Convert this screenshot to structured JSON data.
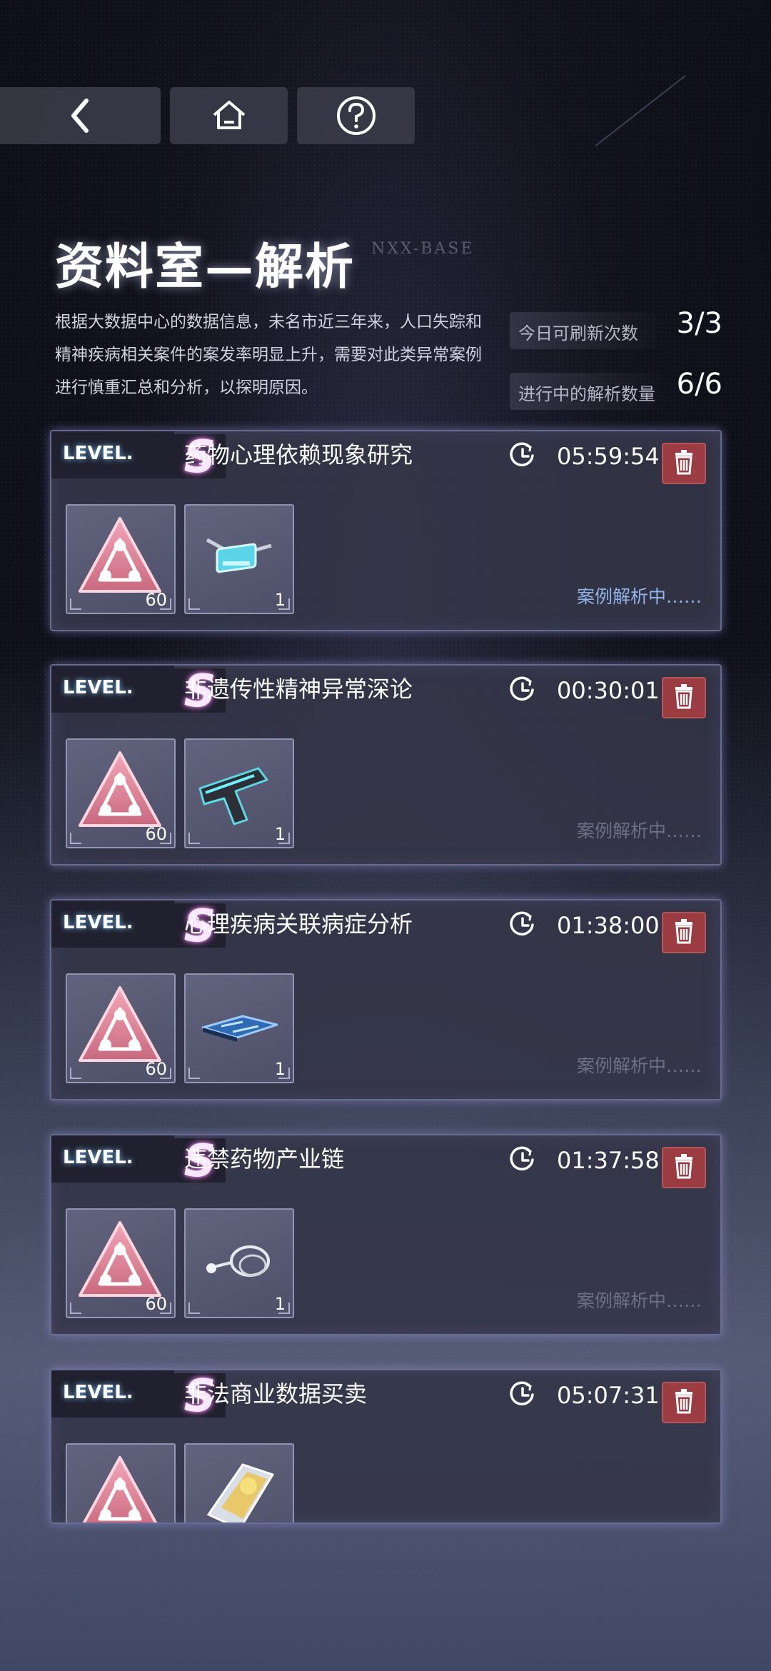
{
  "nav": {
    "back_icon": "chevron-left-icon",
    "home_icon": "home-icon",
    "help_icon": "question-circle-icon"
  },
  "header": {
    "title": "资料室—解析",
    "subtitle": "NXX-BASE",
    "description": "根据大数据中心的数据信息，未名市近三年来，人口失踪和精神疾病相关案件的案发率明显上升，需要对此类异常案例进行慎重汇总和分析，以探明原因。"
  },
  "stats": {
    "refresh_label": "今日可刷新次数",
    "refresh_value": "3/3",
    "analyzing_label": "进行中的解析数量",
    "analyzing_value": "6/6"
  },
  "colors": {
    "card_border": "#9696cd",
    "trash_bg": "#9a3c42",
    "status_active": "#8fb4e8",
    "status_inactive": "#6d6f85"
  },
  "cases": [
    {
      "level_prefix": "LEVEL.",
      "level": "S",
      "title": "药物心理依赖现象研究",
      "timer": "05:59:54",
      "item1_icon": "pink-triangle-emblem-icon",
      "item1_qty": "60",
      "item2_icon": "glasses-icon",
      "item2_qty": "1",
      "status": "案例解析中……",
      "status_active": true
    },
    {
      "level_prefix": "LEVEL.",
      "level": "S",
      "title": "非遗传性精神异常深论",
      "timer": "00:30:01",
      "item1_icon": "pink-triangle-emblem-icon",
      "item1_qty": "60",
      "item2_icon": "pistol-icon",
      "item2_qty": "1",
      "status": "案例解析中……",
      "status_active": false
    },
    {
      "level_prefix": "LEVEL.",
      "level": "S",
      "title": "心理疾病关联病症分析",
      "timer": "01:38:00",
      "item1_icon": "pink-triangle-emblem-icon",
      "item1_qty": "60",
      "item2_icon": "circuit-board-icon",
      "item2_qty": "1",
      "status": "案例解析中……",
      "status_active": false
    },
    {
      "level_prefix": "LEVEL.",
      "level": "S",
      "title": "违禁药物产业链",
      "timer": "01:37:58",
      "item1_icon": "pink-triangle-emblem-icon",
      "item1_qty": "60",
      "item2_icon": "stethoscope-icon",
      "item2_qty": "1",
      "status": "案例解析中……",
      "status_active": false
    },
    {
      "level_prefix": "LEVEL.",
      "level": "S",
      "title": "非法商业数据买卖",
      "timer": "05:07:31",
      "item1_icon": "pink-triangle-emblem-icon",
      "item1_qty": "",
      "item2_icon": "cards-icon",
      "item2_qty": "",
      "status": "",
      "status_active": false
    }
  ]
}
